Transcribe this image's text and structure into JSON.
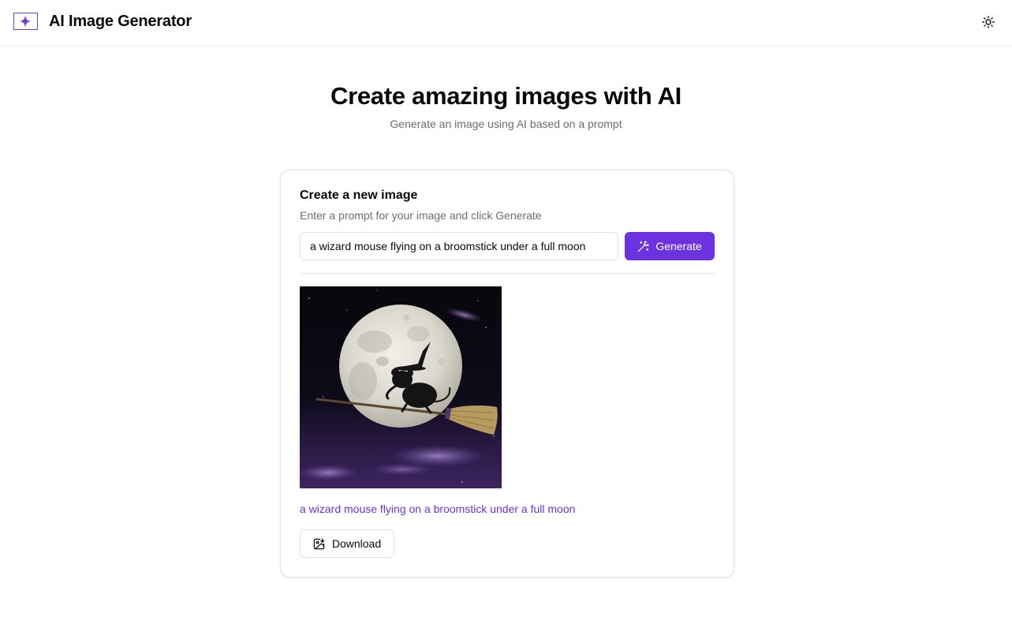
{
  "header": {
    "app_title": "AI Image Generator",
    "logo_icon": "sparkle-icon",
    "theme_icon": "sun-icon",
    "accent_color": "#6d32e0"
  },
  "hero": {
    "title": "Create amazing images with AI",
    "subtitle": "Generate an image using AI based on a prompt"
  },
  "card": {
    "title": "Create a new image",
    "description": "Enter a prompt for your image and click Generate",
    "prompt_value": "a wizard mouse flying on a broomstick under a full moon",
    "generate_label": "Generate",
    "generate_icon": "magic-wand-icon",
    "result": {
      "image_subject": "a mouse in a witch hat flying on a broomstick in front of a full moon",
      "caption": "a wizard mouse flying on a broomstick under a full moon",
      "download_label": "Download",
      "download_icon": "image-download-icon"
    }
  }
}
